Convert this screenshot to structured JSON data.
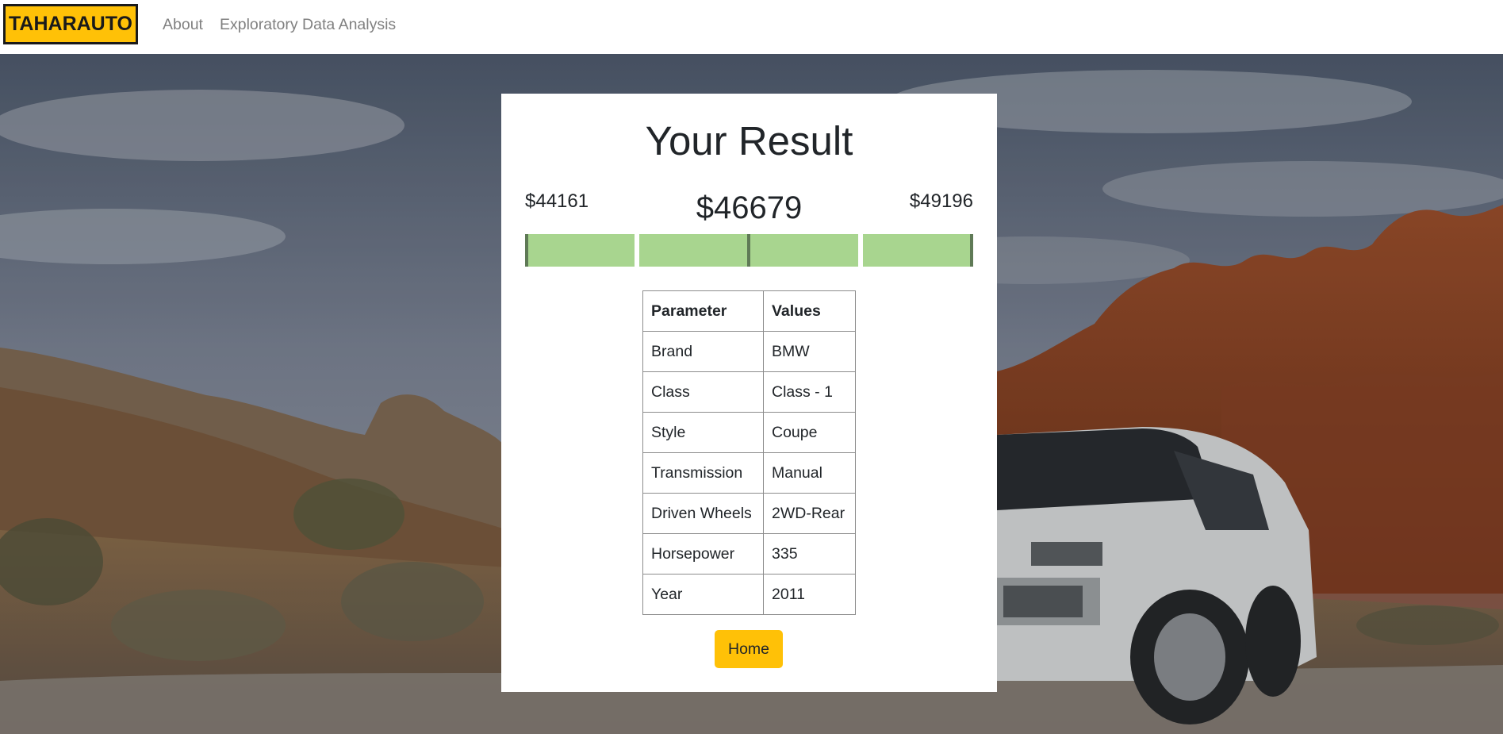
{
  "navbar": {
    "brand": "TAHARAUTO",
    "links": [
      {
        "label": "About"
      },
      {
        "label": "Exploratory Data Analysis"
      }
    ]
  },
  "result": {
    "title": "Your Result",
    "price_low": "$44161",
    "price_estimate": "$46679",
    "price_high": "$49196",
    "range_colors": {
      "fill": "#a8d58f",
      "marker": "#5f7a56"
    }
  },
  "table": {
    "headers": [
      "Parameter",
      "Values"
    ],
    "rows": [
      [
        "Brand",
        "BMW"
      ],
      [
        "Class",
        "Class - 1"
      ],
      [
        "Style",
        "Coupe"
      ],
      [
        "Transmission",
        "Manual"
      ],
      [
        "Driven Wheels",
        "2WD-Rear"
      ],
      [
        "Horsepower",
        "335"
      ],
      [
        "Year",
        "2011"
      ]
    ]
  },
  "home_button": {
    "label": "Home"
  },
  "colors": {
    "accent": "#ffc107",
    "text": "#212529",
    "nav_link": "#808080"
  }
}
